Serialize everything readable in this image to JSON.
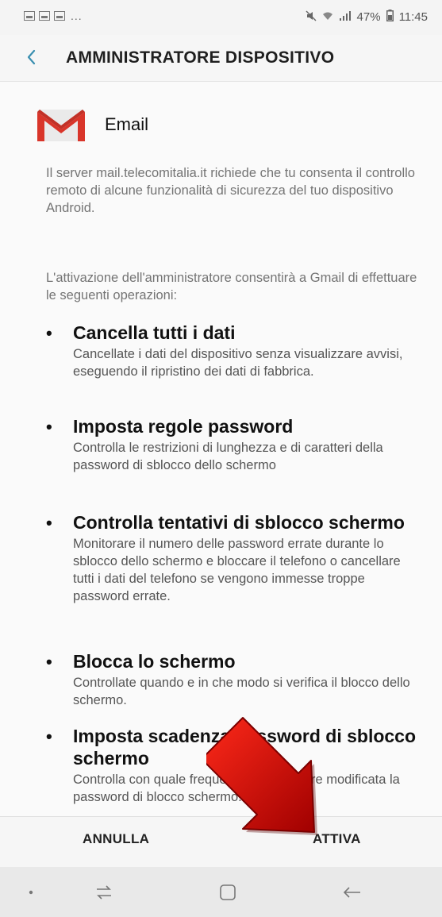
{
  "status_bar": {
    "dots": "...",
    "battery": "47%",
    "time": "11:45"
  },
  "header": {
    "title": "AMMINISTRATORE DISPOSITIVO"
  },
  "app": {
    "name": "Email",
    "icon": "gmail-icon"
  },
  "description": "Il server mail.telecomitalia.it richiede che tu consenta il controllo remoto di alcune funzionalità di sicurezza del tuo dispositivo Android.",
  "activation_text": "L'attivazione dell'amministratore consentirà a Gmail di effettuare le seguenti operazioni:",
  "permissions": [
    {
      "title": "Cancella tutti i dati",
      "description": "Cancellate i dati del dispositivo senza visualizzare avvisi, eseguendo il ripristino dei dati di fabbrica."
    },
    {
      "title": "Imposta regole password",
      "description": "Controlla le restrizioni di lunghezza e di caratteri della password di sblocco dello schermo"
    },
    {
      "title": "Controlla tentativi di sblocco schermo",
      "description": "Monitorare il numero delle password errate durante lo sblocco dello schermo e bloccare il telefono o cancellare tutti i dati del telefono se vengono immesse troppe password errate."
    },
    {
      "title": "Blocca lo schermo",
      "description": "Controllate quando e in che modo si verifica il blocco dello schermo."
    },
    {
      "title": "Imposta scadenza password di sblocco schermo",
      "description": "Controlla con quale frequenza deve essere modificata la password di blocco schermo."
    }
  ],
  "footer": {
    "cancel_label": "ANNULLA",
    "activate_label": "ATTIVA"
  },
  "colors": {
    "gmail_red": "#d9352a",
    "arrow_red": "#d40000"
  }
}
